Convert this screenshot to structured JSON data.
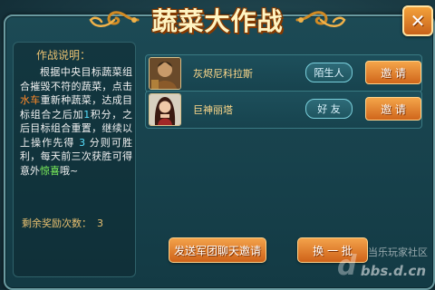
{
  "dialog": {
    "title": "蔬菜大作战",
    "close_icon": "close-x"
  },
  "rules": {
    "heading": "作战说明：",
    "text_parts": [
      {
        "text": "根据中央目标蔬菜组合摧毁不符的蔬菜，点击",
        "color": "white"
      },
      {
        "text": "水车",
        "color": "orange"
      },
      {
        "text": "重新种蔬菜，达成目标组合之后加",
        "color": "white"
      },
      {
        "text": "1",
        "color": "cyan"
      },
      {
        "text": "积分，之后目标组合重置，继续以上操作先得 ",
        "color": "white"
      },
      {
        "text": "3",
        "color": "cyan"
      },
      {
        "text": " 分则可胜利，每天前三次获胜可得意外",
        "color": "white"
      },
      {
        "text": "惊喜",
        "color": "green"
      },
      {
        "text": "哦~",
        "color": "white"
      }
    ]
  },
  "reward": {
    "label": "剩余奖励次数：",
    "count": "3"
  },
  "players": [
    {
      "name": "灰烬尼科拉斯",
      "relation": "陌生人",
      "invite_label": "邀 请",
      "avatar_icon": "armored-warrior-avatar"
    },
    {
      "name": "巨神丽塔",
      "relation": "好 友",
      "invite_label": "邀 请",
      "avatar_icon": "female-warrior-avatar"
    }
  ],
  "actions": {
    "legion_invite": "发送军团聊天邀请",
    "refresh": "换 一 批"
  },
  "watermark": {
    "top": "当乐玩家社区",
    "bottom": "bbs.d.cn",
    "logo": "d"
  },
  "colors": {
    "accent_orange": "#d0661b",
    "panel_teal": "#1c4a55",
    "gold_text": "#e8c070"
  }
}
